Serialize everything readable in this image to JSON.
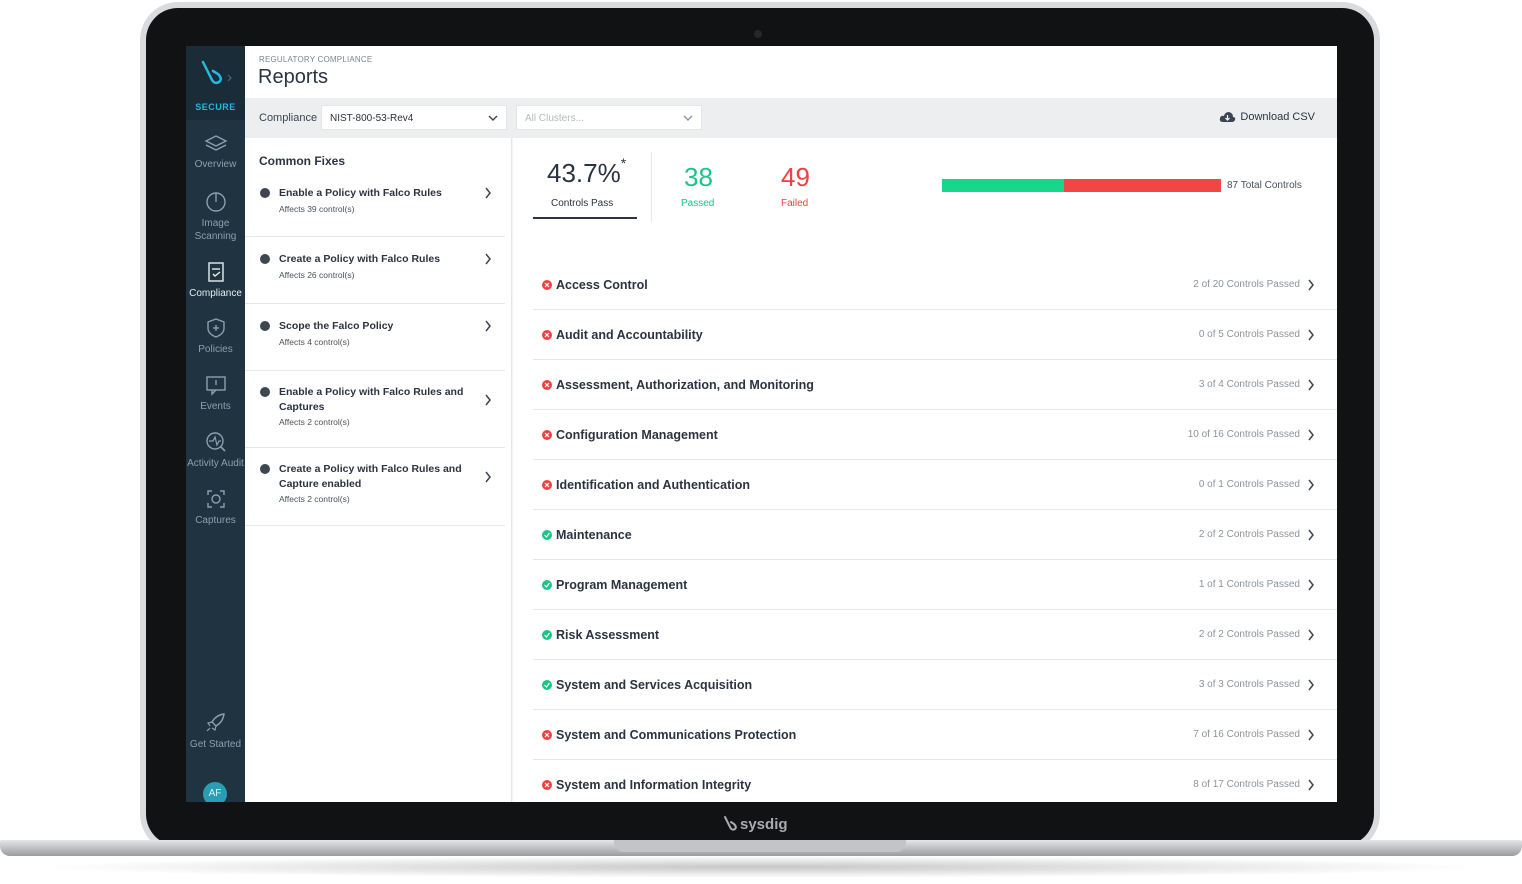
{
  "brand": {
    "name": "sysdig"
  },
  "sidebar": {
    "product": "SECURE",
    "items": [
      {
        "label": "Overview",
        "icon": "layers-icon"
      },
      {
        "label": "Image Scanning",
        "icon": "scan-icon"
      },
      {
        "label": "Compliance",
        "icon": "clipboard-icon"
      },
      {
        "label": "Policies",
        "icon": "shield-icon"
      },
      {
        "label": "Events",
        "icon": "events-icon"
      },
      {
        "label": "Activity Audit",
        "icon": "activity-icon"
      },
      {
        "label": "Captures",
        "icon": "capture-icon"
      }
    ],
    "get_started": "Get Started",
    "avatar_initials": "AF"
  },
  "header": {
    "breadcrumb": "REGULATORY COMPLIANCE",
    "title": "Reports"
  },
  "toolbar": {
    "compliance_label": "Compliance",
    "compliance_value": "NIST-800-53-Rev4",
    "clusters_placeholder": "All Clusters...",
    "download_label": "Download CSV"
  },
  "fixes": {
    "title": "Common Fixes",
    "items": [
      {
        "title": "Enable a Policy with Falco Rules",
        "sub": "Affects 39 control(s)"
      },
      {
        "title": "Create a Policy with Falco Rules",
        "sub": "Affects 26 control(s)"
      },
      {
        "title": "Scope the Falco Policy",
        "sub": "Affects 4 control(s)"
      },
      {
        "title": "Enable a Policy with Falco Rules and Captures",
        "sub": "Affects 2 control(s)"
      },
      {
        "title": "Create a Policy with Falco Rules and Capture enabled",
        "sub": "Affects 2 control(s)"
      }
    ]
  },
  "summary": {
    "pass_rate": "43.7%",
    "pass_rate_mark": "*",
    "pass_rate_label": "Controls Pass",
    "passed": "38",
    "passed_label": "Passed",
    "failed": "49",
    "failed_label": "Failed",
    "passed_count": 38,
    "failed_count": 49,
    "total_label": "87 Total Controls",
    "colors": {
      "pass": "#18d68c",
      "fail": "#f24545"
    }
  },
  "controls": [
    {
      "name": "Access Control",
      "count": "2 of 20 Controls Passed",
      "status": "fail"
    },
    {
      "name": "Audit and Accountability",
      "count": "0 of 5 Controls Passed",
      "status": "fail"
    },
    {
      "name": "Assessment, Authorization, and Monitoring",
      "count": "3 of 4 Controls Passed",
      "status": "fail"
    },
    {
      "name": "Configuration Management",
      "count": "10 of 16 Controls Passed",
      "status": "fail"
    },
    {
      "name": "Identification and Authentication",
      "count": "0 of 1 Controls Passed",
      "status": "fail"
    },
    {
      "name": "Maintenance",
      "count": "2 of 2 Controls Passed",
      "status": "pass"
    },
    {
      "name": "Program Management",
      "count": "1 of 1 Controls Passed",
      "status": "pass"
    },
    {
      "name": "Risk Assessment",
      "count": "2 of 2 Controls Passed",
      "status": "pass"
    },
    {
      "name": "System and Services Acquisition",
      "count": "3 of 3 Controls Passed",
      "status": "pass"
    },
    {
      "name": "System and Communications Protection",
      "count": "7 of 16 Controls Passed",
      "status": "fail"
    },
    {
      "name": "System and Information Integrity",
      "count": "8 of 17 Controls Passed",
      "status": "fail"
    }
  ]
}
